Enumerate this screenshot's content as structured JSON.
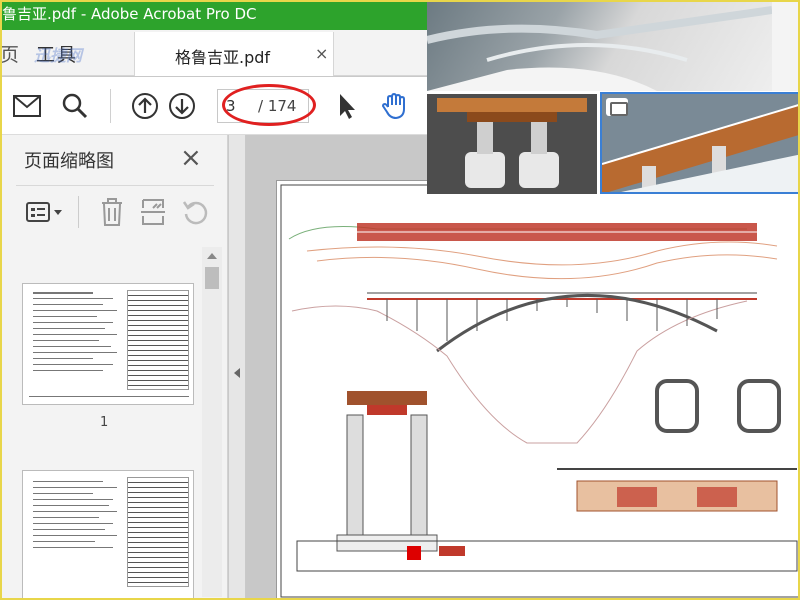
{
  "window": {
    "title": "鲁吉亚.pdf - Adobe Acrobat Pro DC"
  },
  "tabs": {
    "left_stub": "页",
    "tools": "工具",
    "document": "格鲁吉亚.pdf",
    "close_glyph": "×"
  },
  "toolbar": {
    "page_current": "3",
    "page_total": "/ 174",
    "icons": [
      "mail-icon",
      "search-icon",
      "page-up-icon",
      "page-down-icon",
      "select-cursor-icon",
      "hand-tool-icon"
    ]
  },
  "panel": {
    "title": "页面缩略图",
    "close_glyph": "×",
    "thumbnail_1_label": "1",
    "tools": [
      "page-options-icon",
      "delete-icon",
      "extract-icon",
      "rotate-icon"
    ]
  },
  "watermark": "迅捷网",
  "colors": {
    "titlebar": "#2da32c",
    "accent_blue": "#3a7fd5",
    "annotation_red": "#e02020",
    "drawing_red": "#c0392b"
  }
}
